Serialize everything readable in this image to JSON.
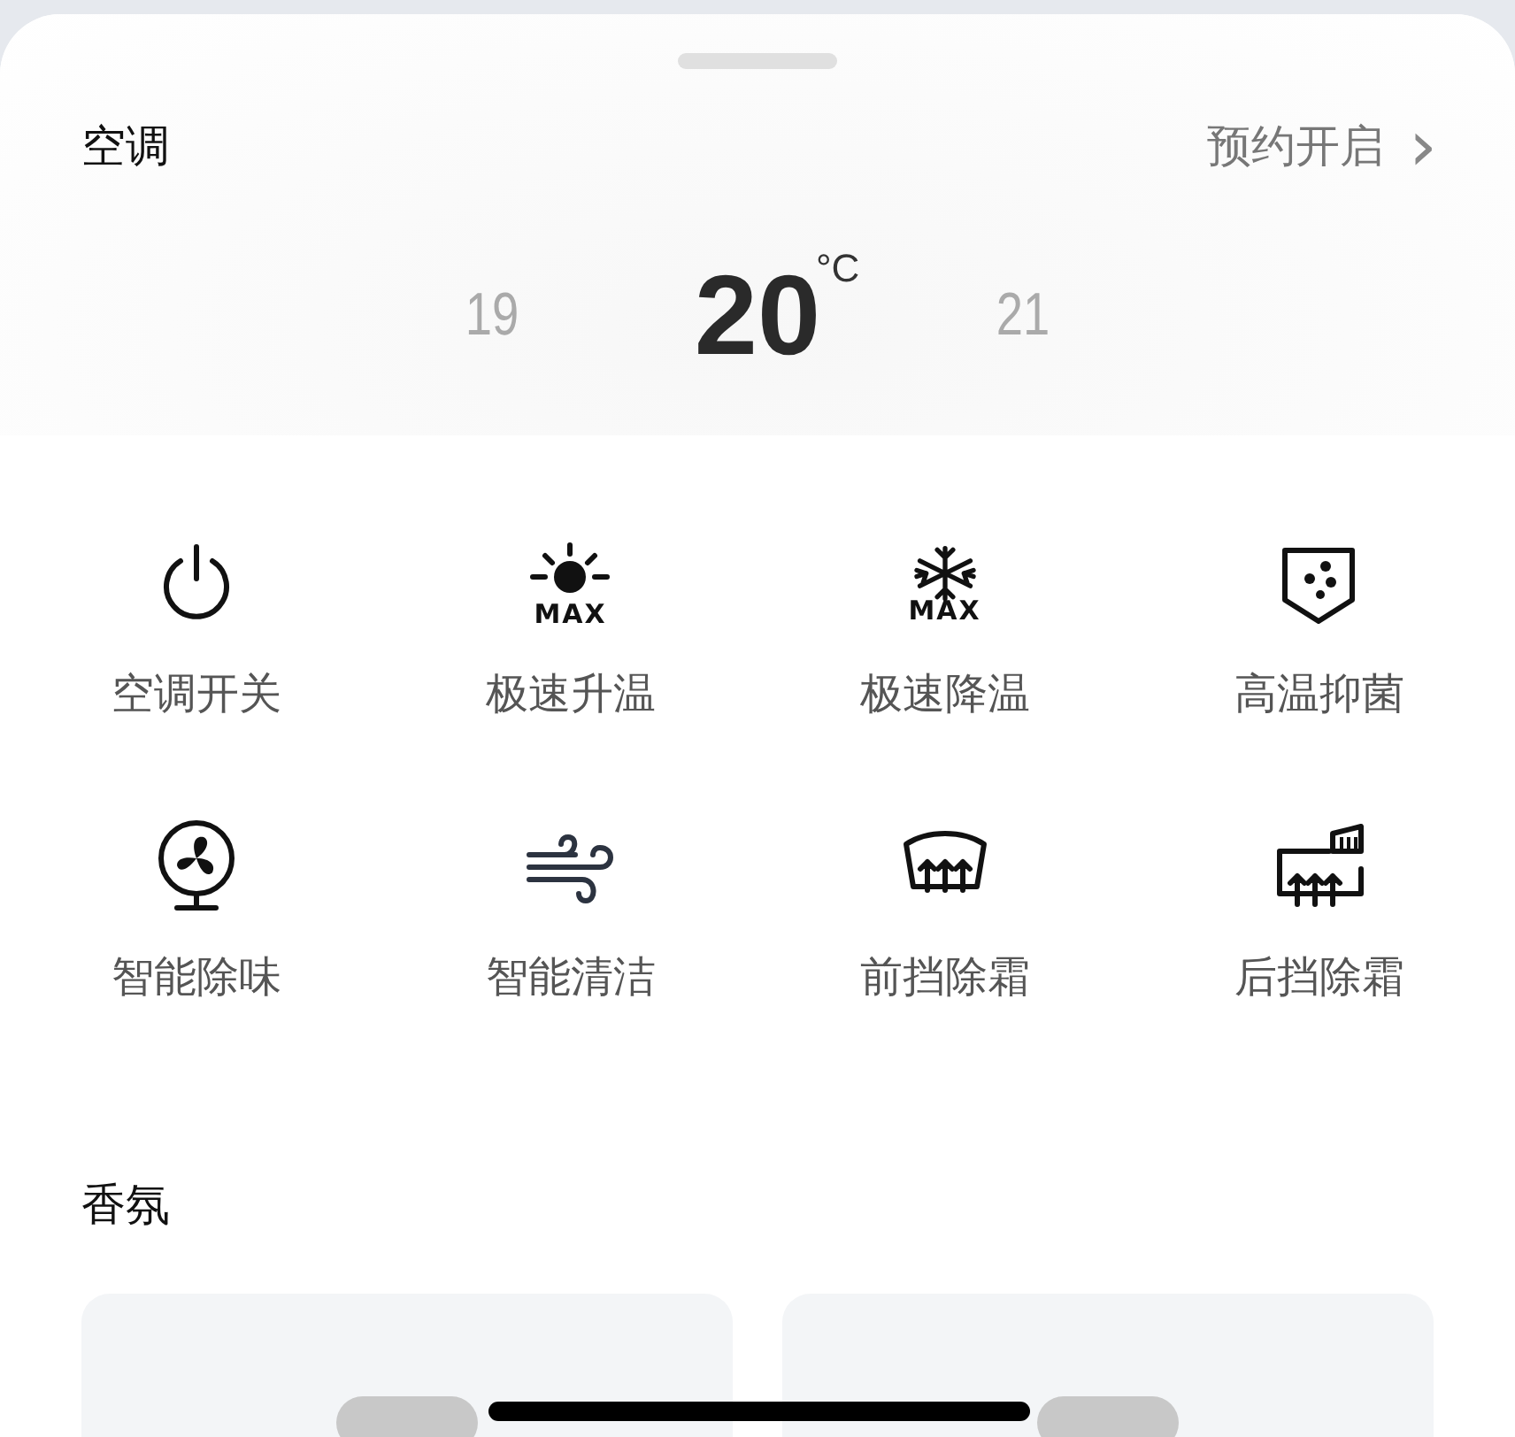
{
  "air_conditioner": {
    "title": "空调",
    "schedule_link": "预约开启",
    "chevron": "›",
    "temperature": {
      "unit": "°C",
      "values": [
        {
          "value": "19",
          "selected": false
        },
        {
          "value": "20",
          "selected": true
        },
        {
          "value": "21",
          "selected": false
        }
      ]
    },
    "controls": [
      {
        "kind": "power",
        "label": "空调开关"
      },
      {
        "kind": "heat",
        "label": "极速升温",
        "badge": "MAX"
      },
      {
        "kind": "cool",
        "label": "极速降温",
        "badge": "MAX"
      },
      {
        "kind": "shield",
        "label": "高温抑菌"
      },
      {
        "kind": "fan",
        "label": "智能除味"
      },
      {
        "kind": "wind",
        "label": "智能清洁"
      },
      {
        "kind": "front-defrost",
        "label": "前挡除霜"
      },
      {
        "kind": "rear-defrost",
        "label": "后挡除霜"
      }
    ]
  },
  "fragrance": {
    "title": "香氛",
    "cards": [
      {
        "kind": "fragrance-card"
      },
      {
        "kind": "fragrance-card"
      }
    ]
  }
}
